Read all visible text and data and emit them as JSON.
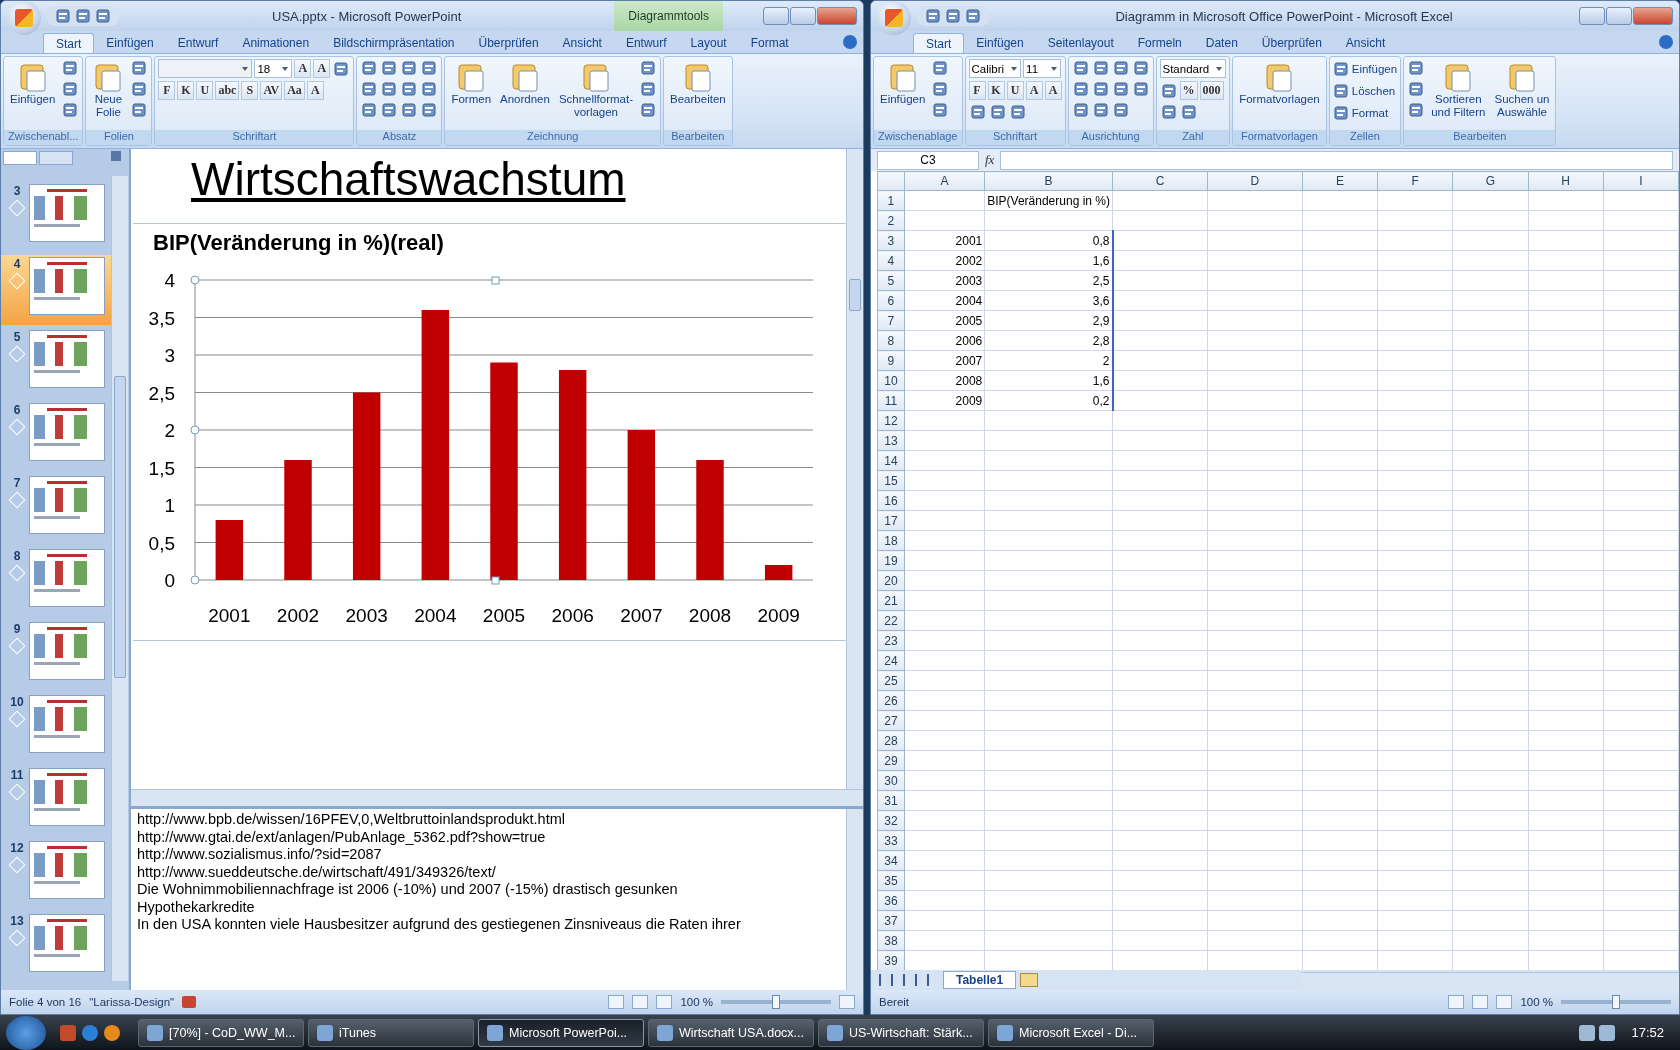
{
  "powerpoint": {
    "title": "USA.pptx - Microsoft PowerPoint",
    "context_tab": "Diagrammtools",
    "tabs": [
      {
        "label": "Start",
        "selected": true
      },
      {
        "label": "Einfügen",
        "selected": false
      },
      {
        "label": "Entwurf",
        "selected": false
      },
      {
        "label": "Animationen",
        "selected": false
      },
      {
        "label": "Bildschirmpräsentation",
        "selected": false
      },
      {
        "label": "Überprüfen",
        "selected": false
      },
      {
        "label": "Ansicht",
        "selected": false
      },
      {
        "label": "Entwurf",
        "selected": false
      },
      {
        "label": "Layout",
        "selected": false
      },
      {
        "label": "Format",
        "selected": false
      }
    ],
    "groups": [
      {
        "label": "Zwischenabl...",
        "items": [
          {
            "kind": "large",
            "label": "Einfügen"
          },
          {
            "kind": "column",
            "items": [
              {
                "kind": "icon"
              },
              {
                "kind": "icon"
              },
              {
                "kind": "icon"
              }
            ]
          }
        ]
      },
      {
        "label": "Folien",
        "items": [
          {
            "kind": "large",
            "label": "Neue\nFolie"
          },
          {
            "kind": "column",
            "items": [
              {
                "kind": "icon"
              },
              {
                "kind": "icon"
              },
              {
                "kind": "icon"
              }
            ]
          }
        ]
      },
      {
        "label": "Schriftart",
        "items": [
          {
            "kind": "column",
            "items": [
              {
                "kind": "row",
                "items": [
                  {
                    "kind": "field"
                  },
                  {
                    "kind": "field",
                    "value": "18"
                  },
                  {
                    "kind": "text",
                    "label": "A"
                  },
                  {
                    "kind": "text",
                    "label": "A"
                  },
                  {
                    "kind": "icon"
                  }
                ]
              },
              {
                "kind": "row",
                "items": [
                  {
                    "kind": "text",
                    "label": "F"
                  },
                  {
                    "kind": "text",
                    "label": "K"
                  },
                  {
                    "kind": "text",
                    "label": "U"
                  },
                  {
                    "kind": "text",
                    "label": "abc"
                  },
                  {
                    "kind": "text",
                    "label": "S"
                  },
                  {
                    "kind": "text",
                    "label": "AV"
                  },
                  {
                    "kind": "text",
                    "label": "Aa"
                  },
                  {
                    "kind": "text",
                    "label": "A"
                  }
                ]
              }
            ]
          }
        ]
      },
      {
        "label": "Absatz",
        "items": [
          {
            "kind": "column",
            "items": [
              {
                "kind": "row",
                "items": [
                  {
                    "kind": "icon"
                  },
                  {
                    "kind": "icon"
                  },
                  {
                    "kind": "icon"
                  },
                  {
                    "kind": "icon"
                  }
                ]
              },
              {
                "kind": "row",
                "items": [
                  {
                    "kind": "icon"
                  },
                  {
                    "kind": "icon"
                  },
                  {
                    "kind": "icon"
                  },
                  {
                    "kind": "icon"
                  }
                ]
              },
              {
                "kind": "row",
                "items": [
                  {
                    "kind": "icon"
                  },
                  {
                    "kind": "icon"
                  },
                  {
                    "kind": "icon"
                  },
                  {
                    "kind": "icon"
                  }
                ]
              }
            ]
          }
        ]
      },
      {
        "label": "Zeichnung",
        "items": [
          {
            "kind": "large",
            "label": "Formen"
          },
          {
            "kind": "large",
            "label": "Anordnen"
          },
          {
            "kind": "large",
            "label": "Schnellformat-\nvorlagen"
          },
          {
            "kind": "column",
            "items": [
              {
                "kind": "icon"
              },
              {
                "kind": "icon"
              },
              {
                "kind": "icon"
              }
            ]
          }
        ]
      },
      {
        "label": "Bearbeiten",
        "items": [
          {
            "kind": "large",
            "label": "Bearbeiten"
          }
        ]
      }
    ],
    "slides": [
      {
        "number": "3",
        "selected": false
      },
      {
        "number": "4",
        "selected": true
      },
      {
        "number": "5",
        "selected": false
      },
      {
        "number": "6",
        "selected": false
      },
      {
        "number": "7",
        "selected": false
      },
      {
        "number": "8",
        "selected": false
      },
      {
        "number": "9",
        "selected": false
      },
      {
        "number": "10",
        "selected": false
      },
      {
        "number": "11",
        "selected": false
      },
      {
        "number": "12",
        "selected": false
      },
      {
        "number": "13",
        "selected": false
      }
    ],
    "slide": {
      "title": "Wirtschaftswachstum",
      "chart_data": {
        "type": "bar",
        "title": "BIP(Veränderung in %)(real)",
        "categories": [
          "2001",
          "2002",
          "2003",
          "2004",
          "2005",
          "2006",
          "2007",
          "2008",
          "2009"
        ],
        "grid": true,
        "series": [
          {
            "color": "#c00000",
            "values": [
              0.8,
              1.6,
              2.5,
              3.6,
              2.9,
              2.8,
              2,
              1.6,
              0.2
            ]
          }
        ],
        "ylim": [
          0,
          4
        ],
        "yticks": [
          {
            "value": 0,
            "label": "0"
          },
          {
            "value": 0.5,
            "label": "0,5"
          },
          {
            "value": 1,
            "label": "1"
          },
          {
            "value": 1.5,
            "label": "1,5"
          },
          {
            "value": 2,
            "label": "2"
          },
          {
            "value": 2.5,
            "label": "2,5"
          },
          {
            "value": 3,
            "label": "3"
          },
          {
            "value": 3.5,
            "label": "3,5"
          },
          {
            "value": 4,
            "label": "4"
          }
        ]
      }
    },
    "notes": [
      "http://www.bpb.de/wissen/16PFEV,0,Weltbruttoinlandsprodukt.html",
      "http://www.gtai.de/ext/anlagen/PubAnlage_5362.pdf?show=true",
      "http://www.sozialismus.info/?sid=2087",
      "http://www.sueddeutsche.de/wirtschaft/491/349326/text/",
      "Die Wohnimmobiliennachfrage ist 2006 (-10%) und 2007 (-15%) drastisch gesunken",
      "Hypothekarkredite",
      "In den USA konnten viele Hausbesitzer aufgrund des gestiegenen Zinsniveaus die Raten ihrer"
    ],
    "status": {
      "slide": "Folie 4 von 16",
      "theme": "\"Larissa-Design\"",
      "zoom": "100 %",
      "zoom_slider": {
        "level": 0.5
      }
    }
  },
  "excel": {
    "title": "Diagramm in Microsoft Office PowerPoint - Microsoft Excel",
    "tabs": [
      {
        "label": "Start",
        "selected": true
      },
      {
        "label": "Einfügen",
        "selected": false
      },
      {
        "label": "Seitenlayout",
        "selected": false
      },
      {
        "label": "Formeln",
        "selected": false
      },
      {
        "label": "Daten",
        "selected": false
      },
      {
        "label": "Überprüfen",
        "selected": false
      },
      {
        "label": "Ansicht",
        "selected": false
      }
    ],
    "groups": [
      {
        "label": "Zwischenablage",
        "items": [
          {
            "kind": "large",
            "label": "Einfügen"
          },
          {
            "kind": "column",
            "items": [
              {
                "kind": "icon"
              },
              {
                "kind": "icon"
              },
              {
                "kind": "icon"
              }
            ]
          }
        ]
      },
      {
        "label": "Schriftart",
        "items": [
          {
            "kind": "column",
            "items": [
              {
                "kind": "row",
                "items": [
                  {
                    "kind": "field",
                    "value": "Calibri"
                  },
                  {
                    "kind": "field",
                    "value": "11"
                  }
                ]
              },
              {
                "kind": "row",
                "items": [
                  {
                    "kind": "text",
                    "label": "F"
                  },
                  {
                    "kind": "text",
                    "label": "K"
                  },
                  {
                    "kind": "text",
                    "label": "U"
                  },
                  {
                    "kind": "text",
                    "label": "A"
                  },
                  {
                    "kind": "text",
                    "label": "A"
                  }
                ]
              },
              {
                "kind": "row",
                "items": [
                  {
                    "kind": "icon"
                  },
                  {
                    "kind": "icon"
                  },
                  {
                    "kind": "icon"
                  }
                ]
              }
            ]
          }
        ]
      },
      {
        "label": "Ausrichtung",
        "items": [
          {
            "kind": "column",
            "items": [
              {
                "kind": "row",
                "items": [
                  {
                    "kind": "icon"
                  },
                  {
                    "kind": "icon"
                  },
                  {
                    "kind": "icon"
                  },
                  {
                    "kind": "icon"
                  }
                ]
              },
              {
                "kind": "row",
                "items": [
                  {
                    "kind": "icon"
                  },
                  {
                    "kind": "icon"
                  },
                  {
                    "kind": "icon"
                  },
                  {
                    "kind": "icon"
                  }
                ]
              },
              {
                "kind": "row",
                "items": [
                  {
                    "kind": "icon"
                  },
                  {
                    "kind": "icon"
                  },
                  {
                    "kind": "icon"
                  }
                ]
              }
            ]
          }
        ]
      },
      {
        "label": "Zahl",
        "items": [
          {
            "kind": "column",
            "items": [
              {
                "kind": "row",
                "items": [
                  {
                    "kind": "field",
                    "value": "Standard"
                  }
                ]
              },
              {
                "kind": "row",
                "items": [
                  {
                    "kind": "icon"
                  },
                  {
                    "kind": "text",
                    "label": "%"
                  },
                  {
                    "kind": "text",
                    "label": "000"
                  }
                ]
              },
              {
                "kind": "row",
                "items": [
                  {
                    "kind": "icon"
                  },
                  {
                    "kind": "icon"
                  }
                ]
              }
            ]
          }
        ]
      },
      {
        "label": "Formatvorlagen",
        "items": [
          {
            "kind": "large",
            "label": "Formatvorlagen"
          }
        ]
      },
      {
        "label": "Zellen",
        "items": [
          {
            "kind": "column",
            "items": [
              {
                "kind": "small",
                "label": "Einfügen"
              },
              {
                "kind": "small",
                "label": "Löschen"
              },
              {
                "kind": "small",
                "label": "Format"
              }
            ]
          }
        ]
      },
      {
        "label": "Bearbeiten",
        "items": [
          {
            "kind": "column",
            "items": [
              {
                "kind": "icon"
              },
              {
                "kind": "icon"
              },
              {
                "kind": "icon"
              }
            ]
          },
          {
            "kind": "large",
            "label": "Sortieren\nund Filtern"
          },
          {
            "kind": "large",
            "label": "Suchen un\nAuswähle"
          }
        ]
      }
    ],
    "name_box": "C3",
    "formula_label": "fx",
    "columns": [
      "A",
      "B",
      "C",
      "D",
      "E",
      "F",
      "G",
      "H",
      "I"
    ],
    "rows": [
      {
        "number": "1",
        "b": "BIP(Veränderung in %)"
      },
      {
        "number": "2"
      },
      {
        "number": "3",
        "a": "2001",
        "b": "0,8"
      },
      {
        "number": "4",
        "a": "2002",
        "b": "1,6"
      },
      {
        "number": "5",
        "a": "2003",
        "b": "2,5"
      },
      {
        "number": "6",
        "a": "2004",
        "b": "3,6"
      },
      {
        "number": "7",
        "a": "2005",
        "b": "2,9"
      },
      {
        "number": "8",
        "a": "2006",
        "b": "2,8"
      },
      {
        "number": "9",
        "a": "2007",
        "b": "2"
      },
      {
        "number": "10",
        "a": "2008",
        "b": "1,6"
      },
      {
        "number": "11",
        "a": "2009",
        "b": "0,2"
      },
      {
        "number": "12"
      },
      {
        "number": "13"
      },
      {
        "number": "14"
      },
      {
        "number": "15"
      },
      {
        "number": "16"
      },
      {
        "number": "17"
      },
      {
        "number": "18"
      },
      {
        "number": "19"
      },
      {
        "number": "20"
      },
      {
        "number": "21"
      },
      {
        "number": "22"
      },
      {
        "number": "23"
      },
      {
        "number": "24"
      },
      {
        "number": "25"
      },
      {
        "number": "26"
      },
      {
        "number": "27"
      },
      {
        "number": "28"
      },
      {
        "number": "29"
      },
      {
        "number": "30"
      },
      {
        "number": "31"
      },
      {
        "number": "32"
      },
      {
        "number": "33"
      },
      {
        "number": "34"
      },
      {
        "number": "35"
      },
      {
        "number": "36"
      },
      {
        "number": "37"
      },
      {
        "number": "38"
      },
      {
        "number": "39"
      }
    ],
    "sheet_tabs": [
      {
        "label": "Tabelle1",
        "selected": true
      }
    ],
    "status": {
      "mode": "Bereit",
      "zoom": "100 %",
      "zoom_slider": {
        "level": 0.5
      }
    }
  },
  "taskbar": {
    "items": [
      {
        "label": "[70%] - CoD_WW_M...",
        "selected": false
      },
      {
        "label": "iTunes",
        "selected": false
      },
      {
        "label": "Microsoft PowerPoi...",
        "selected": true
      },
      {
        "label": "Wirtschaft USA.docx...",
        "selected": false
      },
      {
        "label": "US-Wirtschaft: Stärk...",
        "selected": false
      },
      {
        "label": "Microsoft Excel - Di...",
        "selected": false
      }
    ],
    "clock": "17:52"
  }
}
